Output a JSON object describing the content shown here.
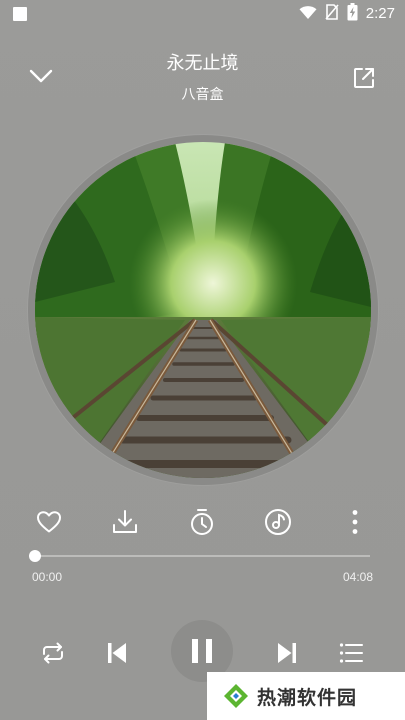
{
  "status_bar": {
    "time": "2:27",
    "icons": [
      "notification-square-icon",
      "wifi-icon",
      "no-sim-icon",
      "battery-charging-icon"
    ]
  },
  "header": {
    "collapse_icon": "chevron-down-icon",
    "title": "永无止境",
    "artist": "八音盒",
    "share_icon": "share-external-icon"
  },
  "album": {
    "art_description_icon": "album-art-railway-forest"
  },
  "actions": [
    {
      "name": "favorite",
      "icon": "heart-outline-icon"
    },
    {
      "name": "download",
      "icon": "download-icon"
    },
    {
      "name": "sleep-timer",
      "icon": "timer-icon"
    },
    {
      "name": "sound-effect",
      "icon": "music-disc-icon"
    },
    {
      "name": "more",
      "icon": "more-vertical-icon"
    }
  ],
  "progress": {
    "current_time": "00:00",
    "total_time": "04:08",
    "fraction": 0.0
  },
  "controls": {
    "repeat_icon": "repeat-icon",
    "previous_icon": "skip-previous-icon",
    "play_pause_icon": "pause-icon",
    "next_icon": "skip-next-icon",
    "playlist_icon": "playlist-icon"
  },
  "watermark": {
    "text": "热潮软件园",
    "logo_icon": "diamond-logo-icon"
  },
  "colors": {
    "background": "#9a9a98",
    "foreground": "#ffffff",
    "watermark_text": "#333333",
    "watermark_logo_green": "#5cb531",
    "watermark_logo_blue": "#2a7fd4"
  }
}
